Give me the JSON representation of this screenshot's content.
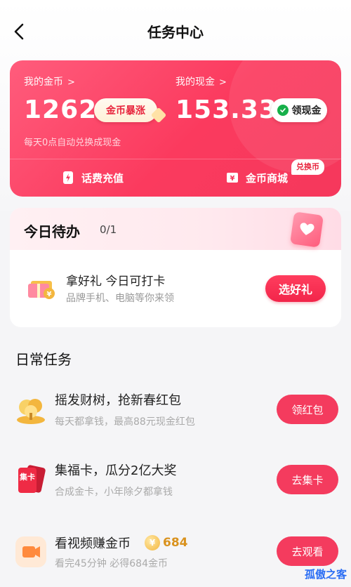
{
  "header": {
    "title": "任务中心"
  },
  "wallet": {
    "coins_label": "我的金币",
    "coins_value": "1262",
    "coins_boost_label": "金币暴涨",
    "cash_label": "我的现金",
    "cash_value": "153.33",
    "cash_button_label": "领现金",
    "auto_exchange_note": "每天0点自动兑换成现金",
    "actions": [
      {
        "label": "话费充值",
        "icon": "lightning-icon"
      },
      {
        "label": "金币商城",
        "icon": "store-icon",
        "badge": "兑换币"
      }
    ]
  },
  "todo": {
    "title": "今日待办",
    "progress": "0/1",
    "item": {
      "title": "拿好礼 今日可打卡",
      "subtitle": "品牌手机、电脑等你来领",
      "button": "选好礼"
    }
  },
  "daily": {
    "title": "日常任务",
    "tasks": [
      {
        "title": "摇发财树，抢新春红包",
        "subtitle": "每天都拿钱，最高88元现金红包",
        "button": "领红包",
        "icon": "money-tree-icon"
      },
      {
        "title": "集福卡，瓜分2亿大奖",
        "subtitle": "合成金卡，小年除夕都拿钱",
        "button": "去集卡",
        "icon": "fortune-card-icon"
      },
      {
        "title": "看视频赚金币",
        "coin_reward": "684",
        "subtitle": "看完45分钟 必得684金币",
        "button": "去观看",
        "icon": "video-icon"
      }
    ],
    "card_icon_text": "集卡"
  },
  "watermark": "孤傲之客",
  "colors": {
    "accent": "#f43b5e",
    "card_gradient_start": "#ff5c7c",
    "card_gradient_end": "#f5385c",
    "coin_gold": "#f3b63e"
  }
}
